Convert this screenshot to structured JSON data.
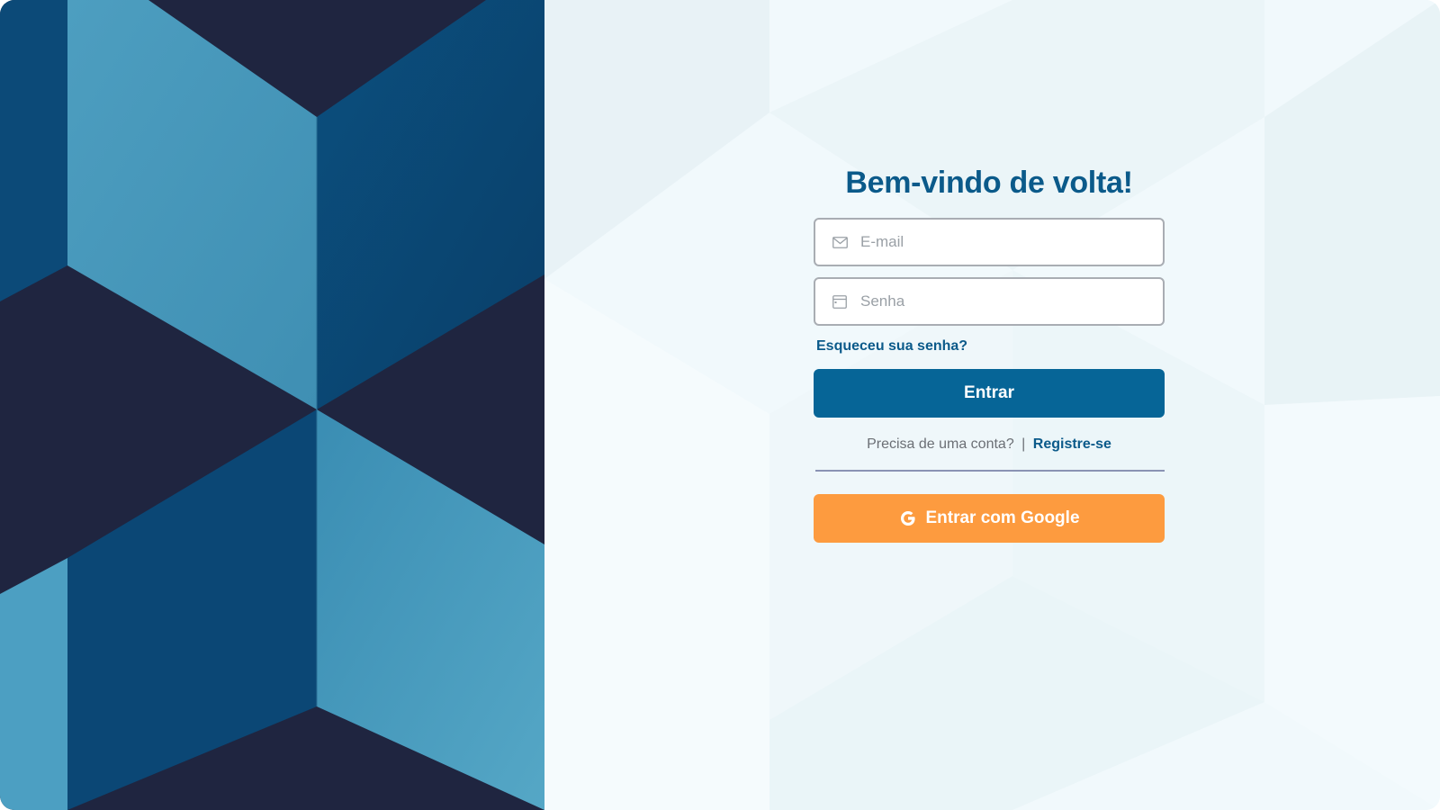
{
  "login": {
    "title": "Bem-vindo de volta!",
    "email_placeholder": "E-mail",
    "password_placeholder": "Senha",
    "forgot_password": "Esqueceu sua senha?",
    "submit_label": "Entrar",
    "register_prompt": "Precisa de uma conta?",
    "register_separator": "|",
    "register_link": "Registre-se",
    "google_label": "Entrar com Google"
  },
  "icons": {
    "email": "envelope-icon",
    "password": "card-icon",
    "google": "google-g-icon"
  },
  "colors": {
    "primary": "#066597",
    "title": "#0b5a8a",
    "google_button": "#fd9b3f",
    "divider": "#8a93b4",
    "muted_text": "#6b6f75"
  }
}
